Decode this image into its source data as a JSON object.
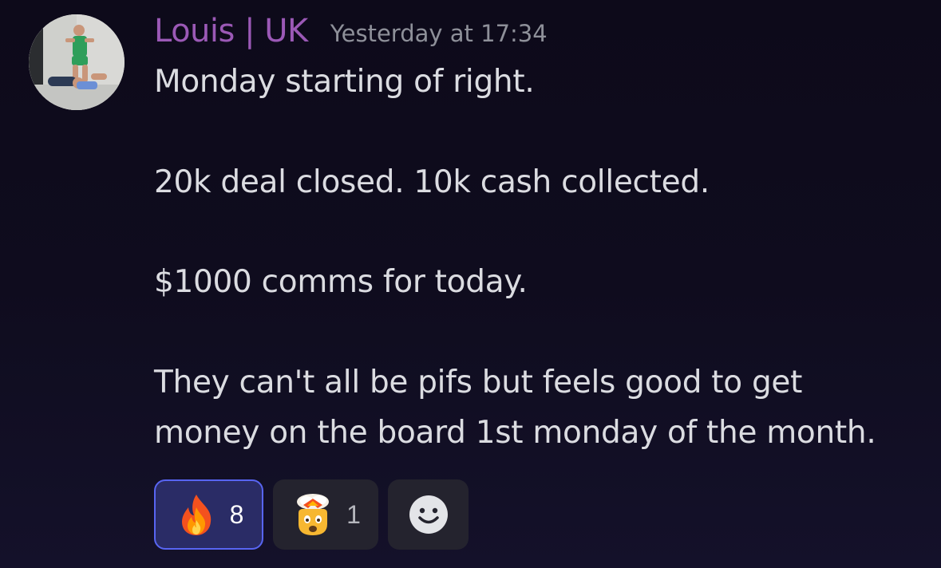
{
  "message": {
    "author": "Louis | UK",
    "author_color": "#9b59b6",
    "timestamp": "Yesterday at 17:34",
    "lines": [
      "Monday starting of right.",
      "20k deal closed. 10k cash collected.",
      "$1000 comms for today.",
      "They can't all be pifs but feels good to get",
      "money on the board 1st monday of the month."
    ]
  },
  "reactions": [
    {
      "emoji": "fire-emoji",
      "count": "8",
      "reacted": true
    },
    {
      "emoji": "exploding-head-emoji",
      "count": "1",
      "reacted": false
    },
    {
      "emoji": "add-reaction-icon"
    }
  ],
  "colors": {
    "background": "#0f0c1e",
    "text": "#dbdce1",
    "muted": "#8e9099",
    "active_border": "#5865f2",
    "active_fill": "#2a2c66",
    "chip_fill": "#24232e"
  }
}
